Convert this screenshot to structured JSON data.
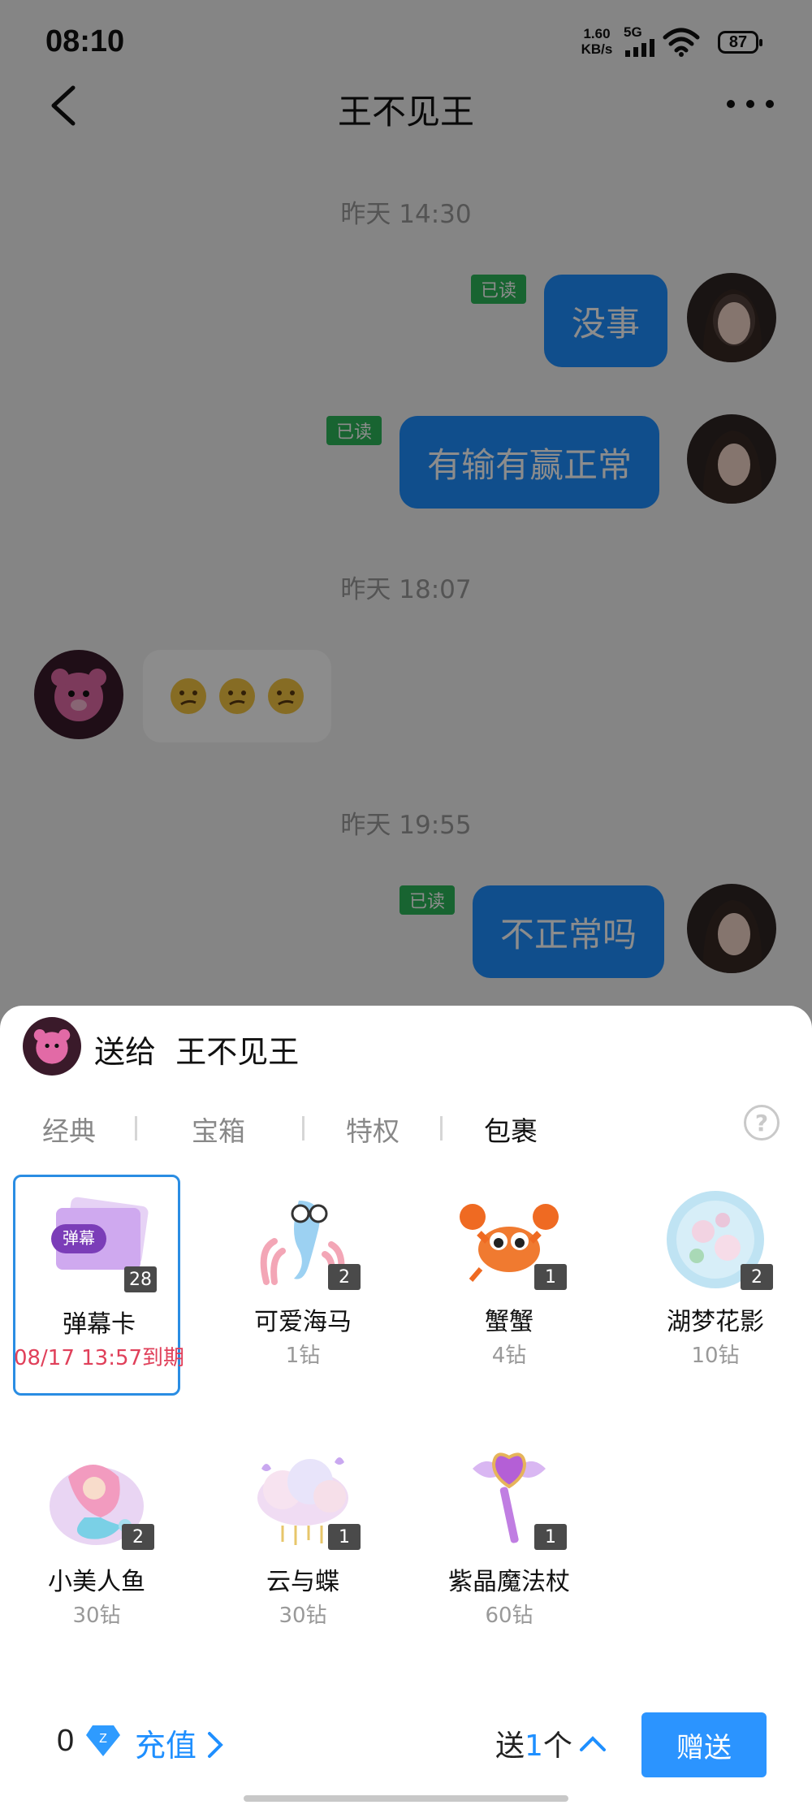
{
  "status_bar": {
    "time": "08:10",
    "net_speed_value": "1.60",
    "net_speed_unit": "KB/s",
    "network": "5G",
    "battery": "87"
  },
  "header": {
    "title": "王不见王"
  },
  "messages": [
    {
      "type": "timestamp",
      "text": "昨天 14:30"
    },
    {
      "type": "outgoing",
      "text": "没事",
      "read": "已读"
    },
    {
      "type": "outgoing",
      "text": "有输有赢正常",
      "read": "已读"
    },
    {
      "type": "timestamp",
      "text": "昨天 18:07"
    },
    {
      "type": "incoming",
      "emojis": [
        "confused-face",
        "confused-face",
        "confused-face"
      ]
    },
    {
      "type": "timestamp",
      "text": "昨天 19:55"
    },
    {
      "type": "outgoing",
      "text": "不正常吗",
      "read": "已读"
    }
  ],
  "gift_panel": {
    "send_to_prefix": "送给",
    "recipient": "王不见王",
    "tabs": [
      {
        "label": "经典",
        "active": false
      },
      {
        "label": "宝箱",
        "active": false
      },
      {
        "label": "特权",
        "active": false
      },
      {
        "label": "包裹",
        "active": true
      }
    ],
    "help": "?",
    "gifts": [
      {
        "name": "弹幕卡",
        "price": "08/17 13:57到期",
        "count": "28",
        "selected": true,
        "badge": "弹幕"
      },
      {
        "name": "可爱海马",
        "price": "1钻",
        "count": "2"
      },
      {
        "name": "蟹蟹",
        "price": "4钻",
        "count": "1"
      },
      {
        "name": "湖梦花影",
        "price": "10钻",
        "count": "2"
      },
      {
        "name": "小美人鱼",
        "price": "30钻",
        "count": "2"
      },
      {
        "name": "云与蝶",
        "price": "30钻",
        "count": "1"
      },
      {
        "name": "紫晶魔法杖",
        "price": "60钻",
        "count": "1"
      }
    ],
    "balance": "0",
    "recharge": "充值",
    "send_prefix": "送",
    "quantity": "1",
    "quantity_unit": "个",
    "give_button": "赠送"
  },
  "colors": {
    "accent": "#1e8fff",
    "read_tag": "#2db65a",
    "expire": "#e0405a"
  }
}
